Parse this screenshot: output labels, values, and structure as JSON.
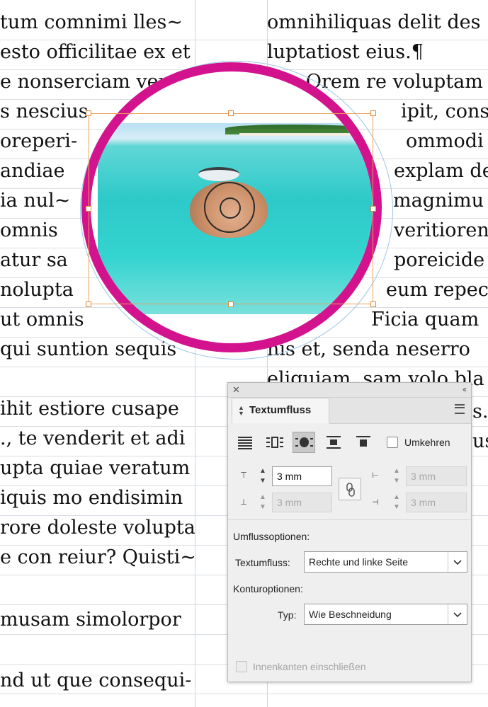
{
  "document": {
    "left_column_lines": [
      "tum comnimi lles~",
      "esto officilitae ex et",
      "e nonserciam venda",
      "s nescius",
      "oreperi-",
      "andiae",
      "ia nul~",
      "omnis",
      "atur sa",
      "nolupta",
      "ut omnis",
      "qui suntion sequis",
      "ihit estiore cusape",
      "., te venderit et adi",
      "upta quiae veratum",
      "iquis mo endisimin",
      "rore doleste volupta",
      "e con reiur? Quisti~",
      "musam simolorpor",
      "nd ut que consequi-"
    ],
    "right_column_lines": [
      "omnihiliquas delit des",
      "luptatiost eius.¶",
      "Ga. Orem re voluptam",
      "ipit, conseq",
      "ommodi",
      "explam de",
      "magnimu",
      "veritioren",
      "poreicide",
      "eum repec",
      "Ficia quam",
      "nis et, senda neserro",
      "eliquiam, sam volo bla",
      "s.¶",
      "us"
    ]
  },
  "panel": {
    "title": "Textumfluss",
    "close_icon": "close-icon",
    "collapse_icon": "double-chevron-left-icon",
    "menu_icon": "hamburger-menu-icon",
    "wrap_buttons": [
      {
        "name": "no-text-wrap",
        "active": false
      },
      {
        "name": "wrap-around-bounding-box",
        "active": false
      },
      {
        "name": "wrap-around-object-shape",
        "active": true
      },
      {
        "name": "jump-object",
        "active": false
      },
      {
        "name": "jump-to-next-column",
        "active": false
      }
    ],
    "invert_label": "Umkehren",
    "offsets": {
      "top": "3 mm",
      "bottom": "3 mm",
      "left": "3 mm",
      "right": "3 mm"
    },
    "wrap_options_heading": "Umflussoptionen:",
    "wrap_to_label": "Textumfluss:",
    "wrap_to_value": "Rechte und linke Seite",
    "contour_heading": "Konturoptionen:",
    "type_label": "Typ:",
    "type_value": "Wie Beschneidung",
    "inside_edges_label": "Innenkanten einschließen"
  },
  "colors": {
    "accent_ring": "#d3138d",
    "frame": "#e9a25a",
    "guide": "#bcd9ee"
  }
}
